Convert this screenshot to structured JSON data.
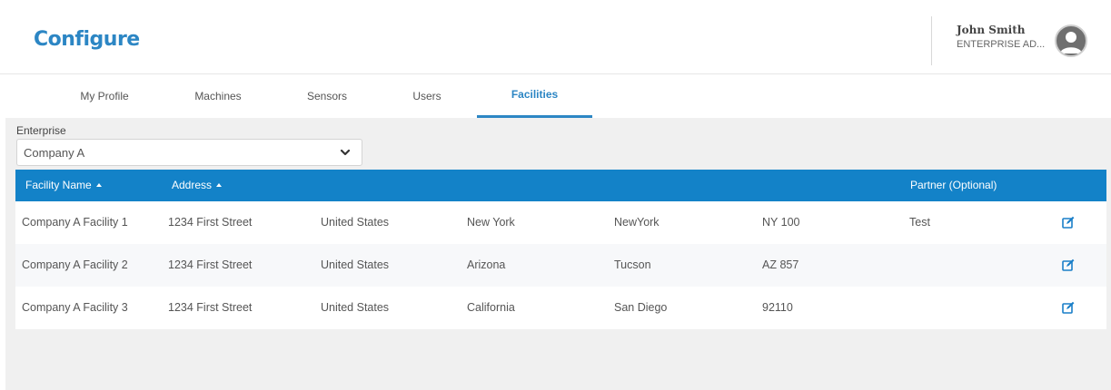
{
  "header": {
    "title": "Configure",
    "user_name": "John Smith",
    "user_role": "ENTERPRISE AD...",
    "title_color": "#2c86c4"
  },
  "tabs": [
    {
      "label": "My Profile",
      "active": false
    },
    {
      "label": "Machines",
      "active": false
    },
    {
      "label": "Sensors",
      "active": false
    },
    {
      "label": "Users",
      "active": false
    },
    {
      "label": "Facilities",
      "active": true
    }
  ],
  "enterprise": {
    "label": "Enterprise",
    "selected": "Company A",
    "icon": "chevron-down-icon"
  },
  "table": {
    "header_color": "#1382c8",
    "columns": [
      "Facility Name",
      "Address",
      "",
      "",
      "",
      "",
      "Partner (Optional)",
      ""
    ],
    "sortable": [
      true,
      true,
      false,
      false,
      false,
      false,
      false,
      false
    ],
    "rows": [
      [
        "Company A Facility 1",
        "1234 First Street",
        "United States",
        "New York",
        "NewYork",
        "NY 100",
        "Test"
      ],
      [
        "Company A Facility 2",
        "1234 First Street",
        "United States",
        "Arizona",
        "Tucson",
        "AZ 857",
        ""
      ],
      [
        "Company A Facility 3",
        "1234 First Street",
        "United States",
        "California",
        "San Diego",
        "92110",
        ""
      ]
    ],
    "edit_icon": "edit-icon"
  }
}
